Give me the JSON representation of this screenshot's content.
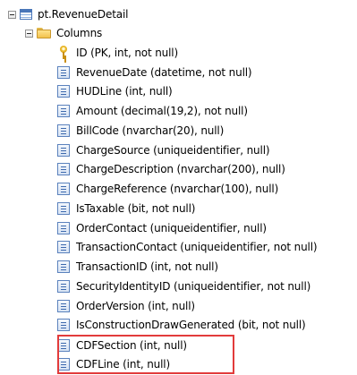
{
  "tree": {
    "table": {
      "label": "pt.RevenueDetail",
      "icon": "table-icon",
      "expanded": true
    },
    "folder": {
      "label": "Columns",
      "icon": "folder-icon",
      "expanded": true
    },
    "columns": [
      {
        "label": "ID (PK, int, not null)",
        "icon": "primary-key-icon"
      },
      {
        "label": "RevenueDate (datetime, not null)",
        "icon": "column-icon"
      },
      {
        "label": "HUDLine (int, null)",
        "icon": "column-icon"
      },
      {
        "label": "Amount (decimal(19,2), not null)",
        "icon": "column-icon"
      },
      {
        "label": "BillCode (nvarchar(20), null)",
        "icon": "column-icon"
      },
      {
        "label": "ChargeSource (uniqueidentifier, null)",
        "icon": "column-icon"
      },
      {
        "label": "ChargeDescription (nvarchar(200), null)",
        "icon": "column-icon"
      },
      {
        "label": "ChargeReference (nvarchar(100), null)",
        "icon": "column-icon"
      },
      {
        "label": "IsTaxable (bit, not null)",
        "icon": "column-icon"
      },
      {
        "label": "OrderContact (uniqueidentifier, null)",
        "icon": "column-icon"
      },
      {
        "label": "TransactionContact (uniqueidentifier, not null)",
        "icon": "column-icon"
      },
      {
        "label": "TransactionID (int, not null)",
        "icon": "column-icon"
      },
      {
        "label": "SecurityIdentityID (uniqueidentifier, not null)",
        "icon": "column-icon"
      },
      {
        "label": "OrderVersion (int, null)",
        "icon": "column-icon"
      },
      {
        "label": "IsConstructionDrawGenerated (bit, not null)",
        "icon": "column-icon"
      },
      {
        "label": "CDFSection (int, null)",
        "icon": "column-icon",
        "highlighted": true
      },
      {
        "label": "CDFLine (int, null)",
        "icon": "column-icon",
        "highlighted": true
      }
    ],
    "highlight_color": "#e23b3b"
  }
}
